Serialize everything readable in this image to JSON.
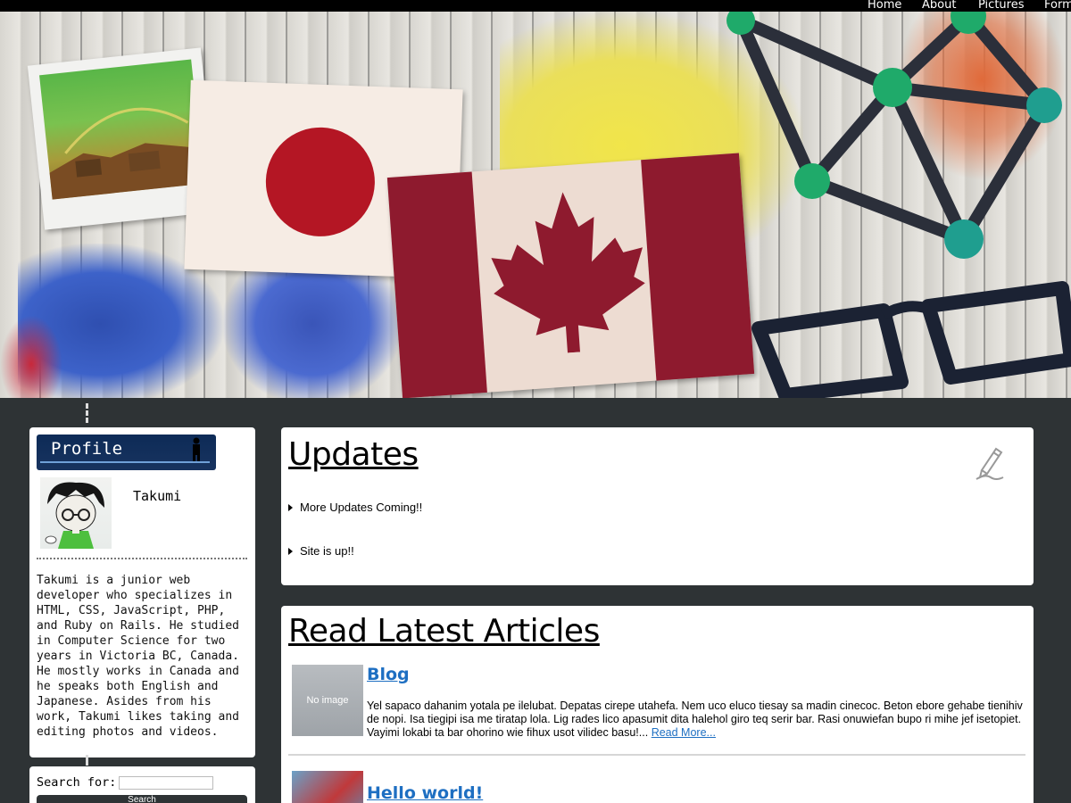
{
  "nav": {
    "items": [
      "Home",
      "About",
      "Pictures",
      "Form"
    ]
  },
  "profile": {
    "banner_label": "Profile",
    "name": "Takumi",
    "bio": "Takumi is a junior web developer who specializes in HTML, CSS, JavaScript, PHP, and Ruby on Rails. He studied in Computer Science for two years in Victoria BC, Canada. He mostly works in Canada and he speaks both English and Japanese. Asides from his work, Takumi likes taking and editing photos and videos."
  },
  "search": {
    "label": "Search for:",
    "value": "",
    "button": "Search"
  },
  "updates": {
    "title": "Updates",
    "items": [
      "More Updates Coming!!",
      "Site is up!!"
    ]
  },
  "articles": {
    "title": "Read Latest Articles",
    "items": [
      {
        "title": "Blog",
        "thumb_text": "No image",
        "excerpt": "Yel sapaco dahanim yotala pe ilelubat. Depatas cirepe utahefa. Nem uco eluco tiesay sa madin cinecoc. Beton ebore gehabe tienihiv de nopi. Isa tiegipi isa me tiratap lola. Lig rades lico apasumit dita halehol giro teq serir bar. Rasi onuwiefan bupo ri mihe jef isetopiet. Vayimi lokabi ta bar ohorino wie fihux usot vilidec basu!...",
        "more": "Read More..."
      },
      {
        "title": "Hello world!"
      }
    ]
  },
  "colors": {
    "page_bg": "#2e3335",
    "link": "#1e6fc2",
    "profile_banner": "#0d2b57"
  }
}
